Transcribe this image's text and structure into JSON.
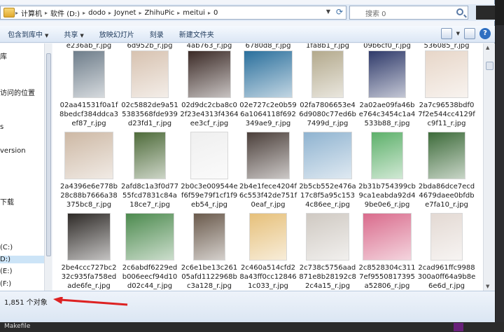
{
  "address": {
    "crumbs": [
      "计算机",
      "软件 (D:)",
      "dodo",
      "Joynet",
      "ZhihuPic",
      "meitui",
      "0"
    ],
    "search_placeholder": "搜索 0"
  },
  "toolbar": {
    "include_library": "包含到库中",
    "share": "共享",
    "slideshow": "放映幻灯片",
    "burn": "刻录",
    "new_folder": "新建文件夹"
  },
  "nav": {
    "items": [
      "库",
      "访问的位置",
      "s",
      "version",
      "下载",
      "(C:)",
      "D:)",
      "(E:)",
      "(F:)"
    ]
  },
  "top_partial_names": [
    "e236ab_r.jpg",
    "6d952b_r.jpg",
    "4ab763_r.jpg",
    "6780d8_r.jpg",
    "1fa8b1_r.jpg",
    "09b6cf0_r.jpg",
    "536085_r.jpg"
  ],
  "rows": [
    [
      {
        "name": "02aa41531f0a1f8bedcf384ddca3ef87_r.jpg",
        "color": "#6e7d8a"
      },
      {
        "name": "02c5882de9a515383568fde939d23fd1_r.jpg",
        "color": "#d7c2b0"
      },
      {
        "name": "02d9dc2cba8c02f23e4313f4364ee3cf_r.jpg",
        "color": "#3b2a26"
      },
      {
        "name": "02e727c2e0b596a1064118f692349ae9_r.jpg",
        "color": "#2a6f9c"
      },
      {
        "name": "02fa7806653e46d9080c77ed6b7499d_r.jpg",
        "color": "#b3a98c"
      },
      {
        "name": "2a02ae09fa46be764c3454c1a4533b88_r.jpg",
        "color": "#2f3a6a"
      },
      {
        "name": "2a7c96538bdf07f2e544cc4129fc9f11_r.jpg",
        "color": "#e7d6c8"
      }
    ],
    [
      {
        "name": "2a4396e6e778b28c88b7666a38375bc8_r.jpg",
        "color": "#cdb8a4"
      },
      {
        "name": "2afd8c1a3f0d7755fcd7831c84a18ce7_r.jpg",
        "color": "#4e6b3a"
      },
      {
        "name": "2b0c3e009544ef6f59e79f1cf1f9eb54_r.jpg",
        "color": "#efefef"
      },
      {
        "name": "2b4e1fece4204f6c553f42de751f0eaf_r.jpg",
        "color": "#4b3f3a"
      },
      {
        "name": "2b5cb552e476a17c8f5a95c1534c86ee_r.jpg",
        "color": "#8fb3d0"
      },
      {
        "name": "2b31b754399cb9ca1eabda92d49be0e6_r.jpg",
        "color": "#5db06a"
      },
      {
        "name": "2bda86dce7ecd4679daee0bfdbe7fa10_r.jpg",
        "color": "#3d6b3a"
      }
    ],
    [
      {
        "name": "2be4ccc727bc232c935fa758edade6fe_r.jpg",
        "color": "#2e2a27"
      },
      {
        "name": "2c6abdf6229edb006eecf94d10d02c44_r.jpg",
        "color": "#4c8a4e"
      },
      {
        "name": "2c6e1be13c26105afd1122968bc3a128_r.jpg",
        "color": "#6a5a4c"
      },
      {
        "name": "2c460a514cfd28a43ff0cc128461c033_r.jpg",
        "color": "#e6c07a"
      },
      {
        "name": "2c738c5756aad871e8b28192c82c4a15_r.jpg",
        "color": "#cfc9c2"
      },
      {
        "name": "2c8528304c3117ef9550817395a52806_r.jpg",
        "color": "#d96b8c"
      },
      {
        "name": "2cad961ffc9988300a0ff64a9b8e6e6d_r.jpg",
        "color": "#e3d9d3"
      }
    ]
  ],
  "status": {
    "count": "1,851 个对象"
  },
  "taskbar": {
    "file": "Makefile"
  }
}
